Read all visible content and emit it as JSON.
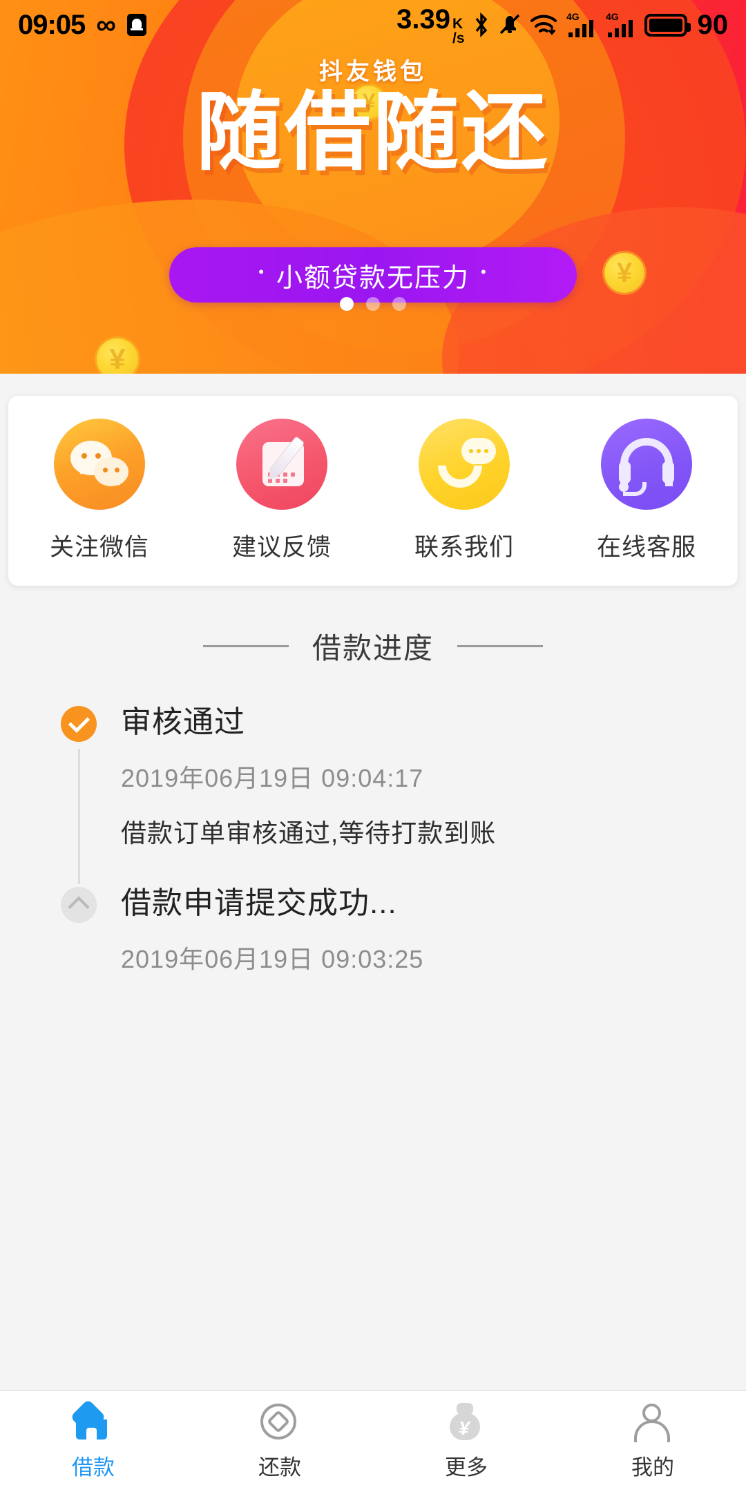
{
  "status_bar": {
    "time": "09:05",
    "infinity_icon": "infinity-icon",
    "notification_icon": "bell-icon",
    "network_speed_value": "3.39",
    "network_speed_unit_top": "K",
    "network_speed_unit_bottom": "/s",
    "bluetooth_icon": "bluetooth-icon",
    "mute_icon": "bell-muted-icon",
    "wifi_icon": "wifi-down-icon",
    "sim1_label": "4G",
    "sim2_label": "4G",
    "battery_icon": "battery-icon",
    "battery_percent": "90"
  },
  "banner": {
    "brand": "抖友钱包",
    "headline": "随借随还",
    "pill_text": "小额贷款无压力",
    "pill_bullet": "•",
    "coin_symbol": "¥",
    "dots_total": 3,
    "dots_active_index": 0,
    "colors": {
      "gradient_start": "#ff9015",
      "gradient_end": "#fa1f3a",
      "pill": "#a817f2",
      "coin": "#fdd732"
    }
  },
  "quick_actions": [
    {
      "label": "关注微信",
      "icon": "wechat-icon",
      "color": "#fca129"
    },
    {
      "label": "建议反馈",
      "icon": "feedback-pencil-icon",
      "color": "#f5576c"
    },
    {
      "label": "联系我们",
      "icon": "phone-chat-icon",
      "color": "#ffd32a"
    },
    {
      "label": "在线客服",
      "icon": "headset-icon",
      "color": "#8356f7"
    }
  ],
  "section": {
    "title": "借款进度"
  },
  "timeline": [
    {
      "title": "审核通过",
      "time": "2019年06月19日 09:04:17",
      "desc": "借款订单审核通过,等待打款到账",
      "state": "done",
      "icon": "check-circle-icon"
    },
    {
      "title": "借款申请提交成功...",
      "time": "2019年06月19日 09:03:25",
      "desc": "",
      "state": "pending",
      "icon": "chevron-up-circle-icon"
    }
  ],
  "tabbar": {
    "active_color": "#2196f3",
    "items": [
      {
        "label": "借款",
        "icon": "home-icon",
        "active": true
      },
      {
        "label": "还款",
        "icon": "coin-icon",
        "active": false
      },
      {
        "label": "更多",
        "icon": "money-bag-icon",
        "active": false
      },
      {
        "label": "我的",
        "icon": "person-icon",
        "active": false
      }
    ]
  }
}
